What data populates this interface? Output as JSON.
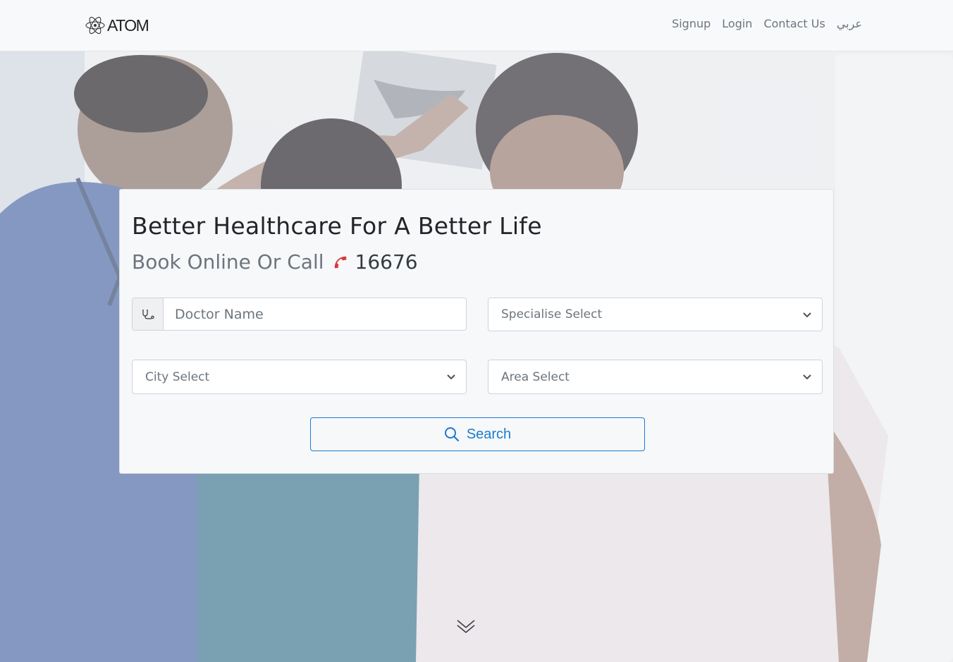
{
  "header": {
    "brand": "ATOM",
    "nav": {
      "signup": "Signup",
      "login": "Login",
      "contact": "Contact Us",
      "language": "عربي"
    }
  },
  "search_card": {
    "title": "Better Healthcare For A Better Life",
    "subtitle": "Book Online Or Call",
    "phone": "16676",
    "doctor_name_placeholder": "Doctor Name",
    "specialise_select": "Specialise Select",
    "city_select": "City Select",
    "area_select": "Area Select",
    "search_label": "Search"
  },
  "colors": {
    "accent": "#1a7bd1",
    "phone_icon": "#d63a3a",
    "muted_text": "#6c757d"
  },
  "icons": {
    "brand": "atom-logo-icon",
    "doctor_field": "stethoscope-icon",
    "phone": "phone-icon",
    "search": "search-icon",
    "dropdown": "chevron-down-icon",
    "scroll": "double-chevron-down-icon"
  }
}
